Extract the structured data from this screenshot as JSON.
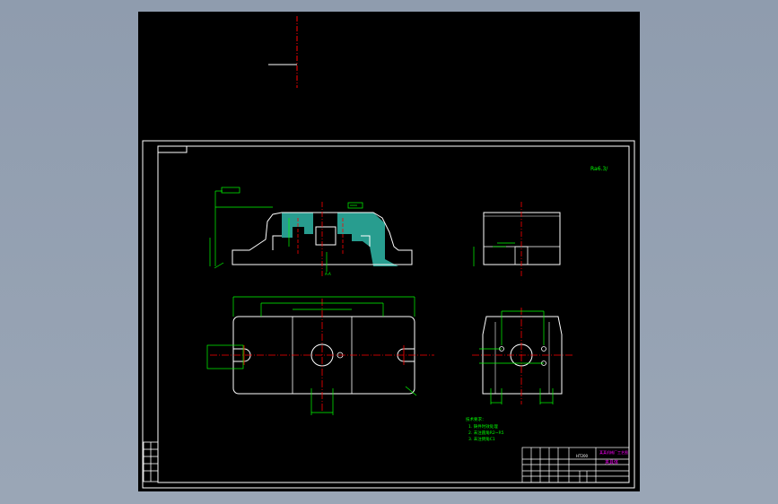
{
  "colors": {
    "background": "#000000",
    "outline": "#ffffff",
    "dimension": "#00ff00",
    "centerline": "#ff0000",
    "hatch": "#2fb8a8",
    "dim_text": "#00ff00",
    "title_text": "#ff00ff"
  },
  "surface_finish_note": "Ra6.3/",
  "technical_requirements": {
    "heading": "技术要求：",
    "items": [
      "1. 铸件时效处理",
      "2. 未注圆角R2~R5",
      "3. 未注倒角C1"
    ]
  },
  "title_block": {
    "drawing_title": "夹具体",
    "school": "某某机械厂工艺图",
    "material": "HT200"
  },
  "section_label": "A-A",
  "icons": [
    "ucs-icon"
  ]
}
